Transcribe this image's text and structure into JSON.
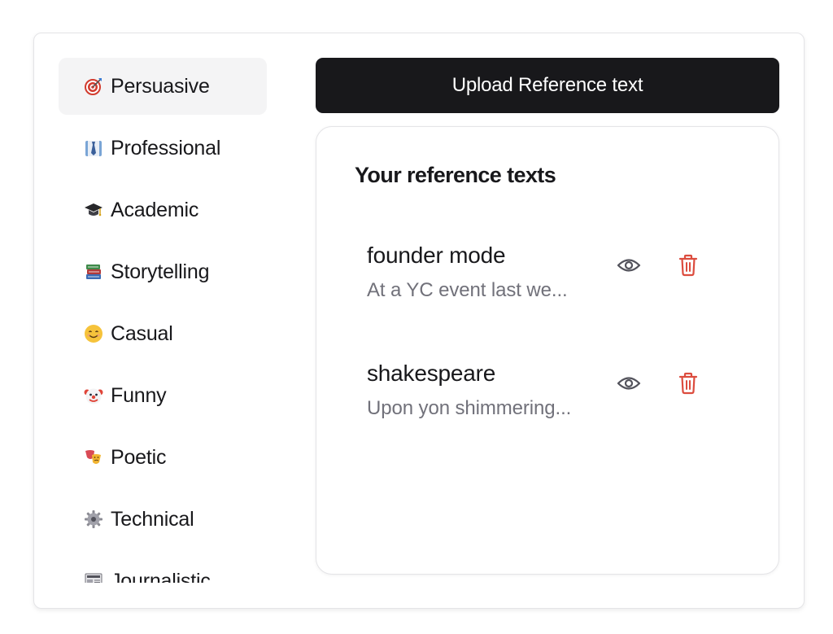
{
  "sidebar": {
    "items": [
      {
        "label": "Persuasive",
        "icon": "target-icon",
        "active": true
      },
      {
        "label": "Professional",
        "icon": "necktie-shirt-icon",
        "active": false
      },
      {
        "label": "Academic",
        "icon": "graduation-cap-icon",
        "active": false
      },
      {
        "label": "Storytelling",
        "icon": "books-icon",
        "active": false
      },
      {
        "label": "Casual",
        "icon": "smiling-face-icon",
        "active": false
      },
      {
        "label": "Funny",
        "icon": "clown-face-icon",
        "active": false
      },
      {
        "label": "Poetic",
        "icon": "theater-masks-icon",
        "active": false
      },
      {
        "label": "Technical",
        "icon": "gear-icon",
        "active": false
      },
      {
        "label": "Journalistic",
        "icon": "newspaper-icon",
        "active": false
      }
    ]
  },
  "upload": {
    "label": "Upload Reference text"
  },
  "references": {
    "title": "Your reference texts",
    "items": [
      {
        "name": "founder mode",
        "preview": "At a YC event last we..."
      },
      {
        "name": "shakespeare",
        "preview": "Upon yon shimmering..."
      }
    ]
  },
  "colors": {
    "primary_button": "#18181b",
    "active_nav_bg": "#f4f4f5",
    "delete_icon": "#dc4c3e",
    "view_icon": "#52525b",
    "muted_text": "#71717a"
  }
}
